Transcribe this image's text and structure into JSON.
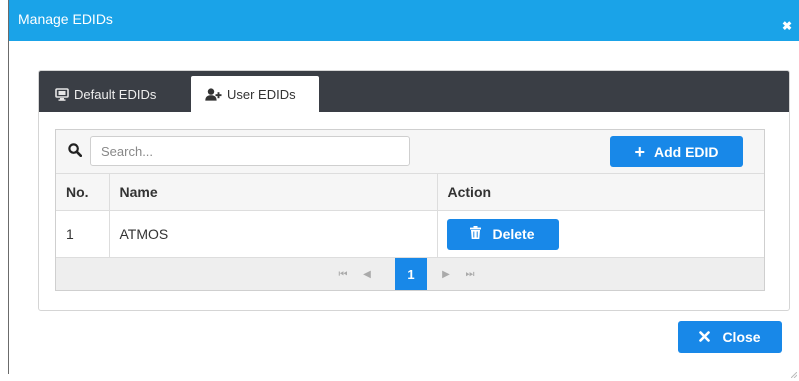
{
  "dialog": {
    "title": "Manage EDIDs",
    "close_glyph": "✖"
  },
  "tabs": [
    {
      "label": "Default EDIDs",
      "icon": "monitor-icon",
      "active": false
    },
    {
      "label": "User EDIDs",
      "icon": "add-user-icon",
      "active": true
    }
  ],
  "search": {
    "placeholder": "Search...",
    "value": ""
  },
  "add_button": {
    "label": "Add EDID",
    "icon": "plus-icon"
  },
  "table": {
    "headers": [
      "No.",
      "Name",
      "Action"
    ],
    "rows": [
      {
        "no": "1",
        "name": "ATMOS",
        "action_label": "Delete",
        "action_icon": "trash-icon"
      }
    ]
  },
  "pagination": {
    "first_glyph": "⏮",
    "prev_glyph": "◀",
    "current_page": "1",
    "next_glyph": "▶",
    "last_glyph": "⏭"
  },
  "close_button": {
    "label": "Close",
    "icon": "x-icon"
  },
  "colors": {
    "accent": "#1888e8",
    "titlebar": "#1aa3e8",
    "tabbar": "#3a3e45"
  }
}
